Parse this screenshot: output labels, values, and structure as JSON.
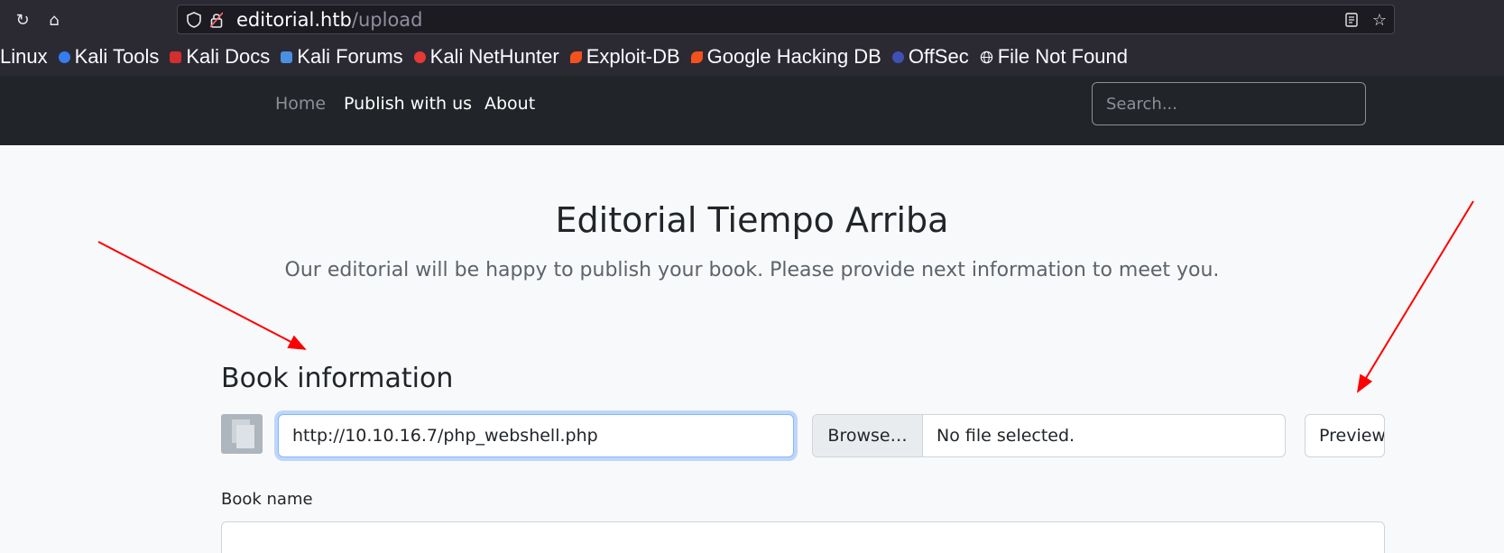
{
  "browser": {
    "url_host": "editorial.htb",
    "url_path": "/upload",
    "bookmarks": [
      {
        "label": "Linux",
        "icon": "",
        "color": ""
      },
      {
        "label": "Kali Tools",
        "icon": "kali-tools-icon",
        "color": "#367bf0"
      },
      {
        "label": "Kali Docs",
        "icon": "kali-docs-icon",
        "color": "#d32f2f"
      },
      {
        "label": "Kali Forums",
        "icon": "kali-forums-icon",
        "color": "#4a90e2"
      },
      {
        "label": "Kali NetHunter",
        "icon": "kali-nethunter-icon",
        "color": "#e53935"
      },
      {
        "label": "Exploit-DB",
        "icon": "exploit-db-icon",
        "color": "#f4511e"
      },
      {
        "label": "Google Hacking DB",
        "icon": "ghdb-icon",
        "color": "#f4511e"
      },
      {
        "label": "OffSec",
        "icon": "offsec-icon",
        "color": "#3f51b5"
      },
      {
        "label": "File Not Found",
        "icon": "globe-icon",
        "color": "#ffffff"
      }
    ]
  },
  "site_nav": {
    "home": "Home",
    "publish": "Publish with us",
    "about": "About",
    "search_placeholder": "Search..."
  },
  "hero": {
    "title": "Editorial Tiempo Arriba",
    "subtitle": "Our editorial will be happy to publish your book. Please provide next information to meet you."
  },
  "book_info": {
    "section_title": "Book information",
    "cover_url_value": "http://10.10.16.7/php_webshell.php",
    "browse_label": "Browse…",
    "file_status": "No file selected.",
    "preview_label": "Preview",
    "book_name_label": "Book name"
  },
  "colors": {
    "accent_focus": "#86b7fe",
    "annotation_arrow": "#ff0000",
    "navbar_bg": "#212529"
  }
}
